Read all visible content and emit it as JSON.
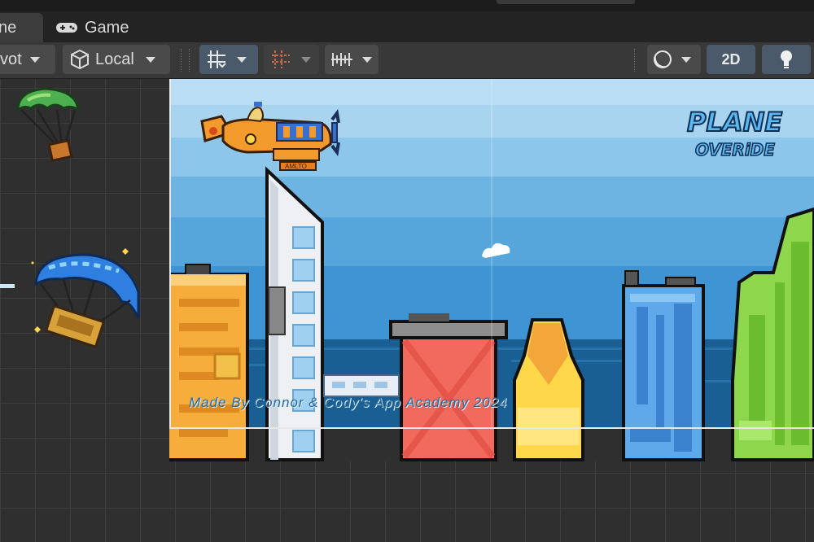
{
  "tabs": [
    {
      "label": "ne",
      "icon": "scene-icon"
    },
    {
      "label": "Game",
      "icon": "gamepad-icon"
    }
  ],
  "toolbar": {
    "pivot_label": "vot",
    "space_label": "Local",
    "mode_2d_label": "2D"
  },
  "game": {
    "logo_line1": "PLANE",
    "logo_line2": "OVERiDE",
    "credit_text": "Made By Connor & Cody's App Academy 2024",
    "plane_tag": "AMLTO"
  },
  "colors": {
    "sky": "#56a6dc",
    "sea": "#1a5f93",
    "plane": "#f39a2c",
    "building_orange": "#f6ad3b",
    "building_red": "#f26a5e",
    "building_yellow": "#ffd84a",
    "building_blue": "#5ea9ea",
    "building_green": "#8ed64c"
  }
}
